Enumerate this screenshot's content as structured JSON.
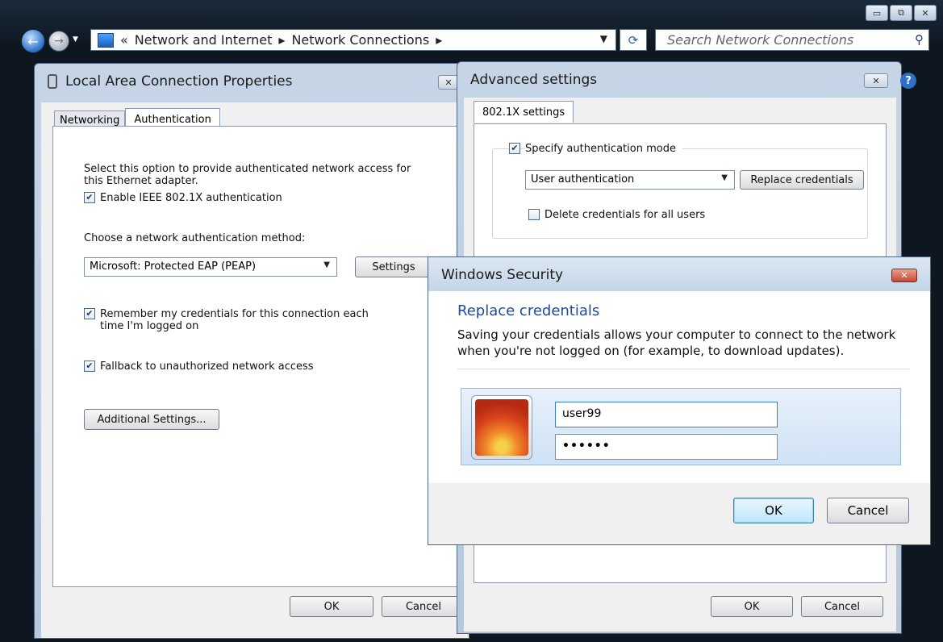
{
  "explorer": {
    "breadcrumb": [
      "Network and Internet",
      "Network Connections"
    ],
    "search_placeholder": "Search Network Connections",
    "glyphs": {
      "prefix": "«",
      "sep": "▸",
      "back": "←",
      "forward": "→",
      "dropdown": "▼",
      "refresh": "⟳",
      "search": "⚲",
      "minimize": "▭",
      "maximize": "⧉",
      "close": "✕"
    }
  },
  "lan_dialog": {
    "title": "Local Area Connection Properties",
    "tabs": [
      "Networking",
      "Authentication"
    ],
    "active_tab": "Authentication",
    "description": "Select this option to provide authenticated network access for this Ethernet adapter.",
    "enable_8021x": {
      "label": "Enable IEEE 802.1X authentication",
      "checked": true
    },
    "method_label": "Choose a network authentication method:",
    "method_value": "Microsoft: Protected EAP (PEAP)",
    "settings_button": "Settings",
    "remember_creds": {
      "label": "Remember my credentials for this connection each time I'm logged on",
      "checked": true
    },
    "fallback": {
      "label": "Fallback to unauthorized network access",
      "checked": true
    },
    "additional_button": "Additional Settings...",
    "ok": "OK",
    "cancel": "Cancel",
    "close_glyph": "✕"
  },
  "advanced_dialog": {
    "title": "Advanced settings",
    "tab": "802.1X settings",
    "specify_mode": {
      "label": "Specify authentication mode",
      "checked": true
    },
    "mode_value": "User authentication",
    "replace_button": "Replace credentials",
    "delete_creds": {
      "label": "Delete credentials for all users",
      "checked": false
    },
    "ok": "OK",
    "cancel": "Cancel",
    "close_glyph": "✕",
    "help_glyph": "?"
  },
  "security_dialog": {
    "title": "Windows Security",
    "heading": "Replace credentials",
    "description": "Saving your credentials allows your computer to connect to the network when you're not logged on (for example, to download updates).",
    "username": "user99",
    "password": "••••••",
    "ok": "OK",
    "cancel": "Cancel",
    "close_glyph": "✕"
  },
  "colors": {
    "heading": "#1e4a9e",
    "close_red": "#c64a32",
    "tile_blue": "#cfe2f6"
  }
}
